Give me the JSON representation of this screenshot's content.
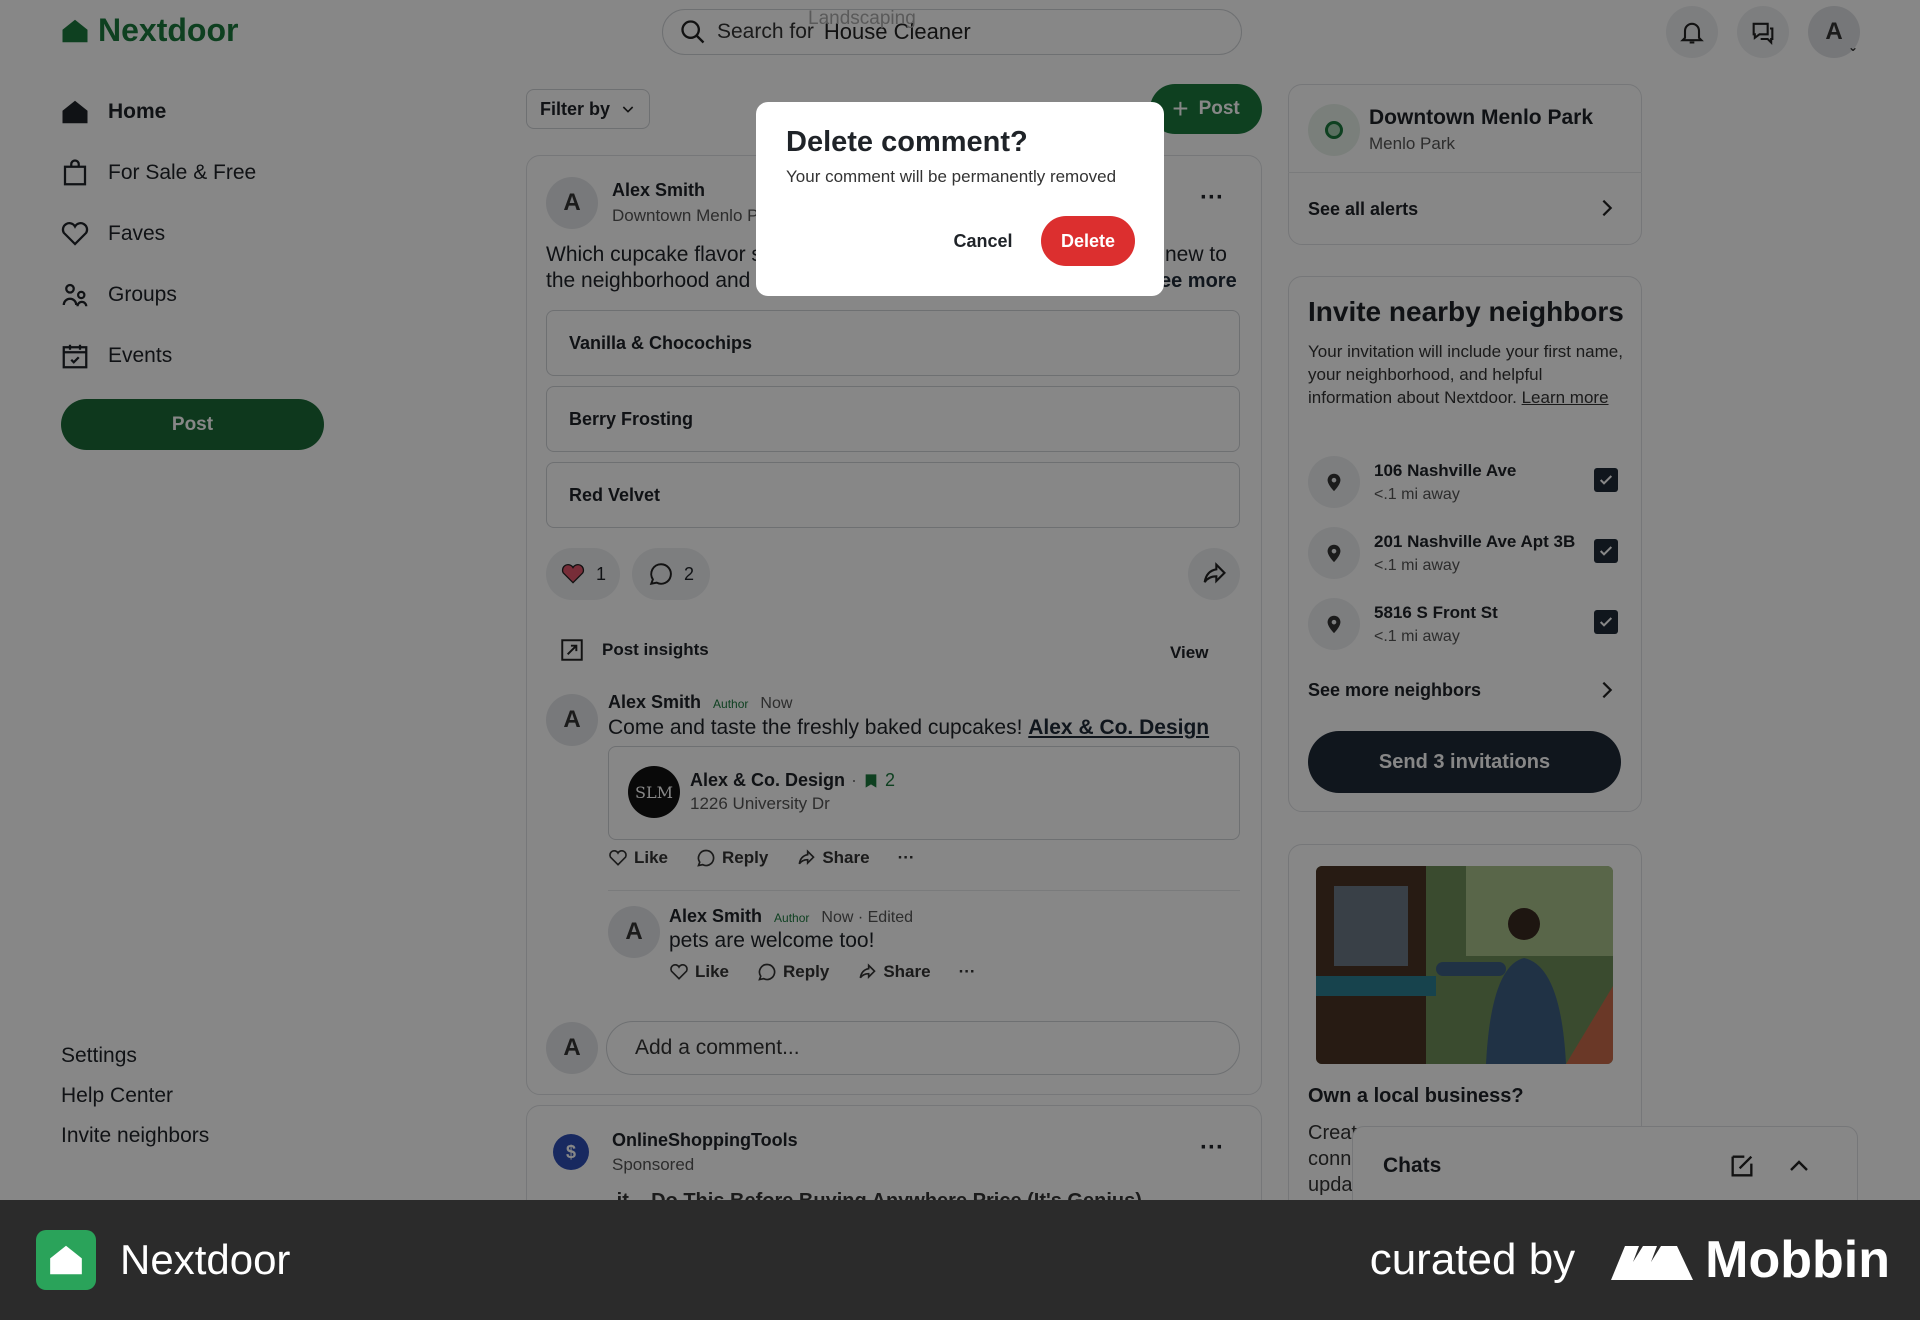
{
  "app": {
    "name": "Nextdoor"
  },
  "search": {
    "prefix": "Search for",
    "hint": "Landscaping",
    "value": "House Cleaner"
  },
  "user": {
    "initial": "A"
  },
  "sidebar": {
    "items": [
      {
        "label": "Home"
      },
      {
        "label": "For Sale & Free"
      },
      {
        "label": "Faves"
      },
      {
        "label": "Groups"
      },
      {
        "label": "Events"
      }
    ],
    "post_label": "Post",
    "footer": [
      "Settings",
      "Help Center",
      "Invite neighbors"
    ]
  },
  "feed": {
    "filter_label": "Filter by",
    "post_label": "Post",
    "post": {
      "author": "Alex Smith",
      "location": "Downtown Menlo P",
      "text_line1_left": "Which cupcake flavor s",
      "text_line1_right": "new to",
      "text_line2_left": "the neighborhood and",
      "see_more": "ee more",
      "poll_options": [
        "Vanilla & Chocochips",
        "Berry Frosting",
        "Red Velvet"
      ],
      "reactions": "1",
      "comments": "2",
      "insights_label": "Post insights",
      "insights_action": "View",
      "comment1": {
        "author": "Alex Smith",
        "tag": "Author",
        "time": "Now",
        "text": "Come and taste the freshly baked cupcakes!",
        "mention": "Alex & Co. Design",
        "business": {
          "logo_text": "SLM",
          "name": "Alex & Co. Design",
          "faves": "2",
          "address": "1226 University Dr"
        }
      },
      "comment2": {
        "author": "Alex Smith",
        "tag": "Author",
        "time": "Now · Edited",
        "text": "pets are welcome too!"
      },
      "actions": {
        "like": "Like",
        "reply": "Reply",
        "share": "Share",
        "more": "···"
      },
      "add_comment_placeholder": "Add a comment..."
    },
    "sponsored": {
      "name": "OnlineShoppingTools",
      "label": "Sponsored",
      "more": "···",
      "text_peek": "...it... Do This Before Buying Anywhere Price (It's Genius)"
    }
  },
  "right": {
    "neighborhood": {
      "name": "Downtown Menlo Park",
      "city": "Menlo Park",
      "alerts_label": "See all alerts"
    },
    "invite": {
      "title": "Invite nearby neighbors",
      "description": "Your invitation will include your first name, your neighborhood, and helpful information about Nextdoor.",
      "learn_more": "Learn more",
      "addresses": [
        {
          "address": "106 Nashville Ave",
          "distance": "<.1 mi away"
        },
        {
          "address": "201 Nashville Ave Apt 3B",
          "distance": "<.1 mi away"
        },
        {
          "address": "5816 S Front St",
          "distance": "<.1 mi away"
        }
      ],
      "see_more": "See more neighbors",
      "button": "Send 3 invitations"
    },
    "business": {
      "title": "Own a local business?",
      "text_peek": [
        "Creat",
        "conn",
        "upda"
      ]
    },
    "chats": {
      "label": "Chats"
    }
  },
  "modal": {
    "title": "Delete comment?",
    "message": "Your comment will be permanently removed",
    "cancel": "Cancel",
    "delete": "Delete"
  },
  "bottom_bar": {
    "app_name": "Nextdoor",
    "curated_by": "curated by",
    "brand": "Mobbin"
  },
  "colors": {
    "brand_green": "#1b7a3e",
    "delete_red": "#dc2f2f",
    "navy": "#1f2a38"
  }
}
